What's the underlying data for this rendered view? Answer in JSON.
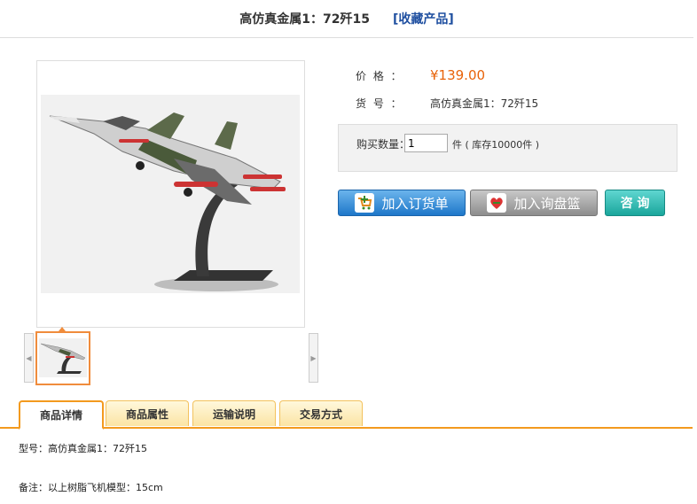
{
  "header": {
    "title": "高仿真金属1：72歼15",
    "collect_label": "[收藏产品]"
  },
  "product": {
    "price_label": "价 格 ：",
    "price": "¥139.00",
    "sku_label": "货 号 ：",
    "sku": "高仿真金属1：72歼15",
    "qty_label": "购买数量：",
    "qty_value": "1",
    "stock_text": "件 ( 库存10000件 )"
  },
  "buttons": {
    "order": "加入订货单",
    "inquiry": "加入询盘篮",
    "consult": "咨 询"
  },
  "tabs": [
    {
      "label": "商品详情"
    },
    {
      "label": "商品属性"
    },
    {
      "label": "运输说明"
    },
    {
      "label": "交易方式"
    }
  ],
  "details": {
    "model": "型号：高仿真金属1：72歼15",
    "note": "备注：以上树脂飞机模型：15cm"
  },
  "colors": {
    "accent": "#f39a1e",
    "price": "#e8630a",
    "link": "#1f4fa0"
  },
  "icons": {
    "order": "cart-icon",
    "inquiry": "heart-basket-icon",
    "thumb_prev": "chevron-left-icon",
    "thumb_next": "chevron-right-icon"
  }
}
